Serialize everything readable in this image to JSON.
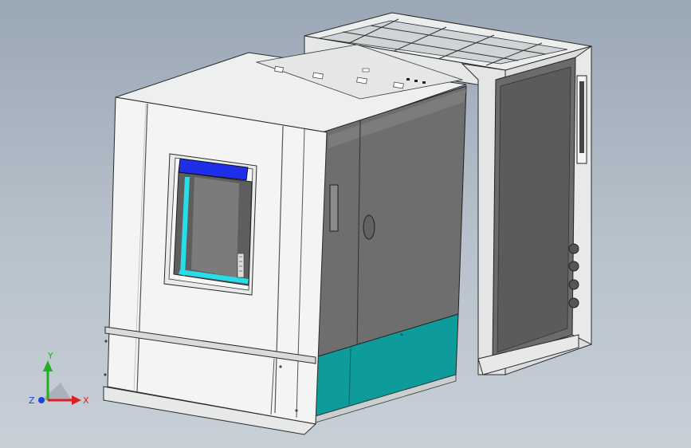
{
  "viewport": {
    "background_top": "#9aa7b5",
    "background_bottom": "#c7cfd7"
  },
  "colors": {
    "panel_white": "#f1f3f2",
    "panel_light": "#dfe2e0",
    "panel_dark": "#6a6a6a",
    "panel_darker": "#555555",
    "teal_base": "#0c9a9a",
    "window_blue": "#2233ee",
    "window_cyan": "#22ddee",
    "edge": "#2a2a2a"
  },
  "triad": {
    "x_label": "X",
    "y_label": "Y",
    "z_label": "Z",
    "x_color": "#e02020",
    "y_color": "#20b020",
    "z_color": "#2040e0"
  }
}
